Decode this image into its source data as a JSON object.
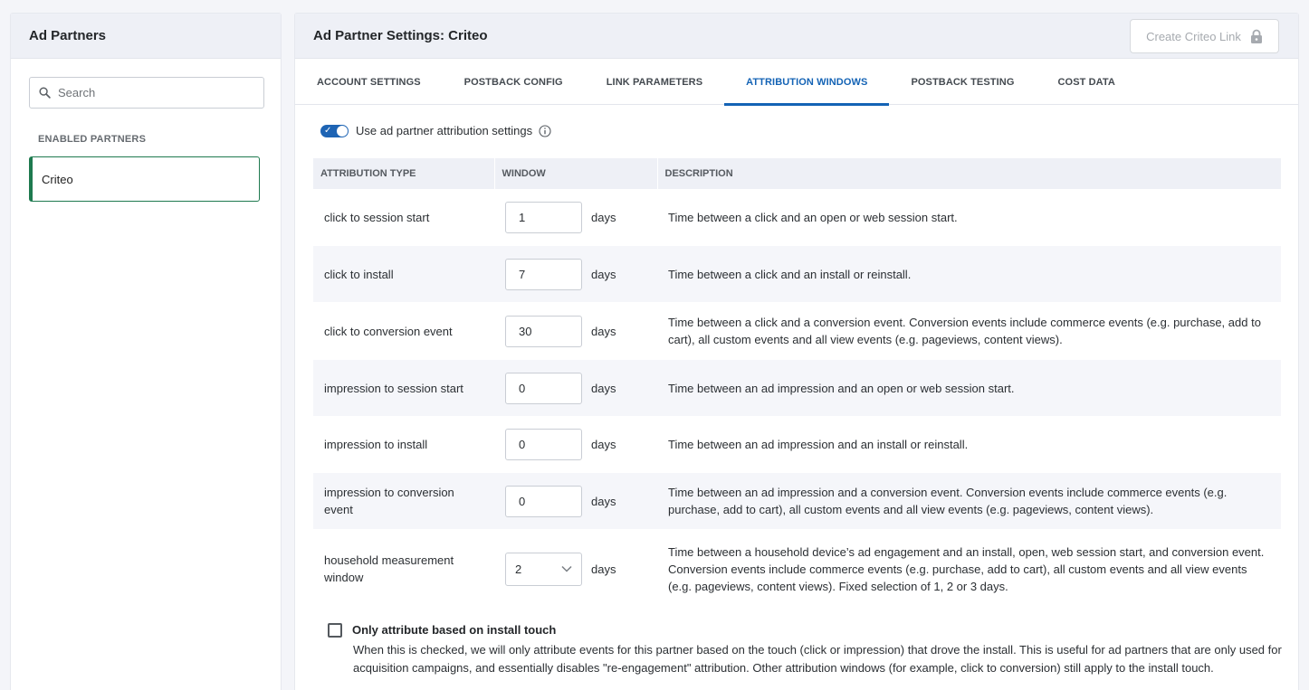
{
  "sidebar": {
    "title": "Ad Partners",
    "search_placeholder": "Search",
    "section_label": "ENABLED PARTNERS",
    "partners": [
      {
        "label": "Criteo"
      }
    ]
  },
  "main": {
    "title": "Ad Partner Settings: Criteo",
    "create_link_label": "Create Criteo Link",
    "tabs": [
      {
        "label": "ACCOUNT SETTINGS",
        "active": false
      },
      {
        "label": "POSTBACK CONFIG",
        "active": false
      },
      {
        "label": "LINK PARAMETERS",
        "active": false
      },
      {
        "label": "ATTRIBUTION WINDOWS",
        "active": true
      },
      {
        "label": "POSTBACK TESTING",
        "active": false
      },
      {
        "label": "COST DATA",
        "active": false
      }
    ],
    "toggle": {
      "label": "Use ad partner attribution settings",
      "on": true
    },
    "table": {
      "headers": [
        "ATTRIBUTION TYPE",
        "WINDOW",
        "DESCRIPTION"
      ],
      "unit": "days",
      "rows": [
        {
          "type": "click to session start",
          "value": "1",
          "description": "Time between a click and an open or web session start."
        },
        {
          "type": "click to install",
          "value": "7",
          "description": "Time between a click and an install or reinstall."
        },
        {
          "type": "click to conversion event",
          "value": "30",
          "description": "Time between a click and a conversion event. Conversion events include commerce events (e.g. purchase, add to cart), all custom events and all view events (e.g. pageviews, content views)."
        },
        {
          "type": "impression to session start",
          "value": "0",
          "description": "Time between an ad impression and an open or web session start."
        },
        {
          "type": "impression to install",
          "value": "0",
          "description": "Time between an ad impression and an install or reinstall."
        },
        {
          "type": "impression to conversion event",
          "value": "0",
          "description": "Time between an ad impression and a conversion event. Conversion events include commerce events (e.g. purchase, add to cart), all custom events and all view events (e.g. pageviews, content views)."
        },
        {
          "type": "household measurement window",
          "value": "2",
          "description": "Time between a household device’s ad engagement and an install, open, web session start, and conversion event. Conversion events include commerce events (e.g. purchase, add to cart), all custom events and all view events (e.g. pageviews, content views). Fixed selection of 1, 2 or 3 days."
        }
      ]
    },
    "install_touch": {
      "label": "Only attribute based on install touch",
      "checked": false,
      "description": "When this is checked, we will only attribute events for this partner based on the touch (click or impression) that drove the install. This is useful for ad partners that are only used for acquisition campaigns, and essentially disables \"re-engagement\" attribution. Other attribution windows (for example, click to conversion) still apply to the install touch."
    }
  }
}
